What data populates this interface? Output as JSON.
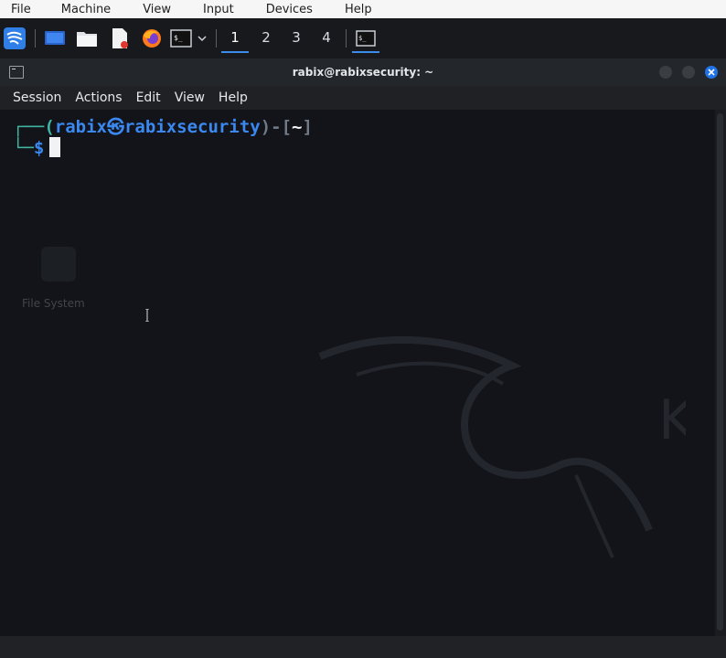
{
  "vbox_menu": [
    "File",
    "Machine",
    "View",
    "Input",
    "Devices",
    "Help"
  ],
  "panel": {
    "workspaces": [
      "1",
      "2",
      "3",
      "4"
    ],
    "active_workspace": "1",
    "launchers": [
      "kali-menu-icon",
      "desktop-icon",
      "file-manager-icon",
      "text-editor-icon",
      "firefox-icon",
      "terminal-icon",
      "dropdown-icon"
    ],
    "accent": "#3b8beb"
  },
  "window": {
    "title": "rabix@rabixsecurity: ~",
    "menu": [
      "Session",
      "Actions",
      "Edit",
      "View",
      "Help"
    ],
    "close_color": "#1f73e8"
  },
  "prompt": {
    "open": "┌──(",
    "user": "rabix",
    "at": "㉿",
    "host": "rabixsecurity",
    "mid": ")-[",
    "dir": "~",
    "close": "]",
    "corner": "└─",
    "symbol": "$"
  },
  "desktop_ghost": {
    "label": "File System"
  }
}
